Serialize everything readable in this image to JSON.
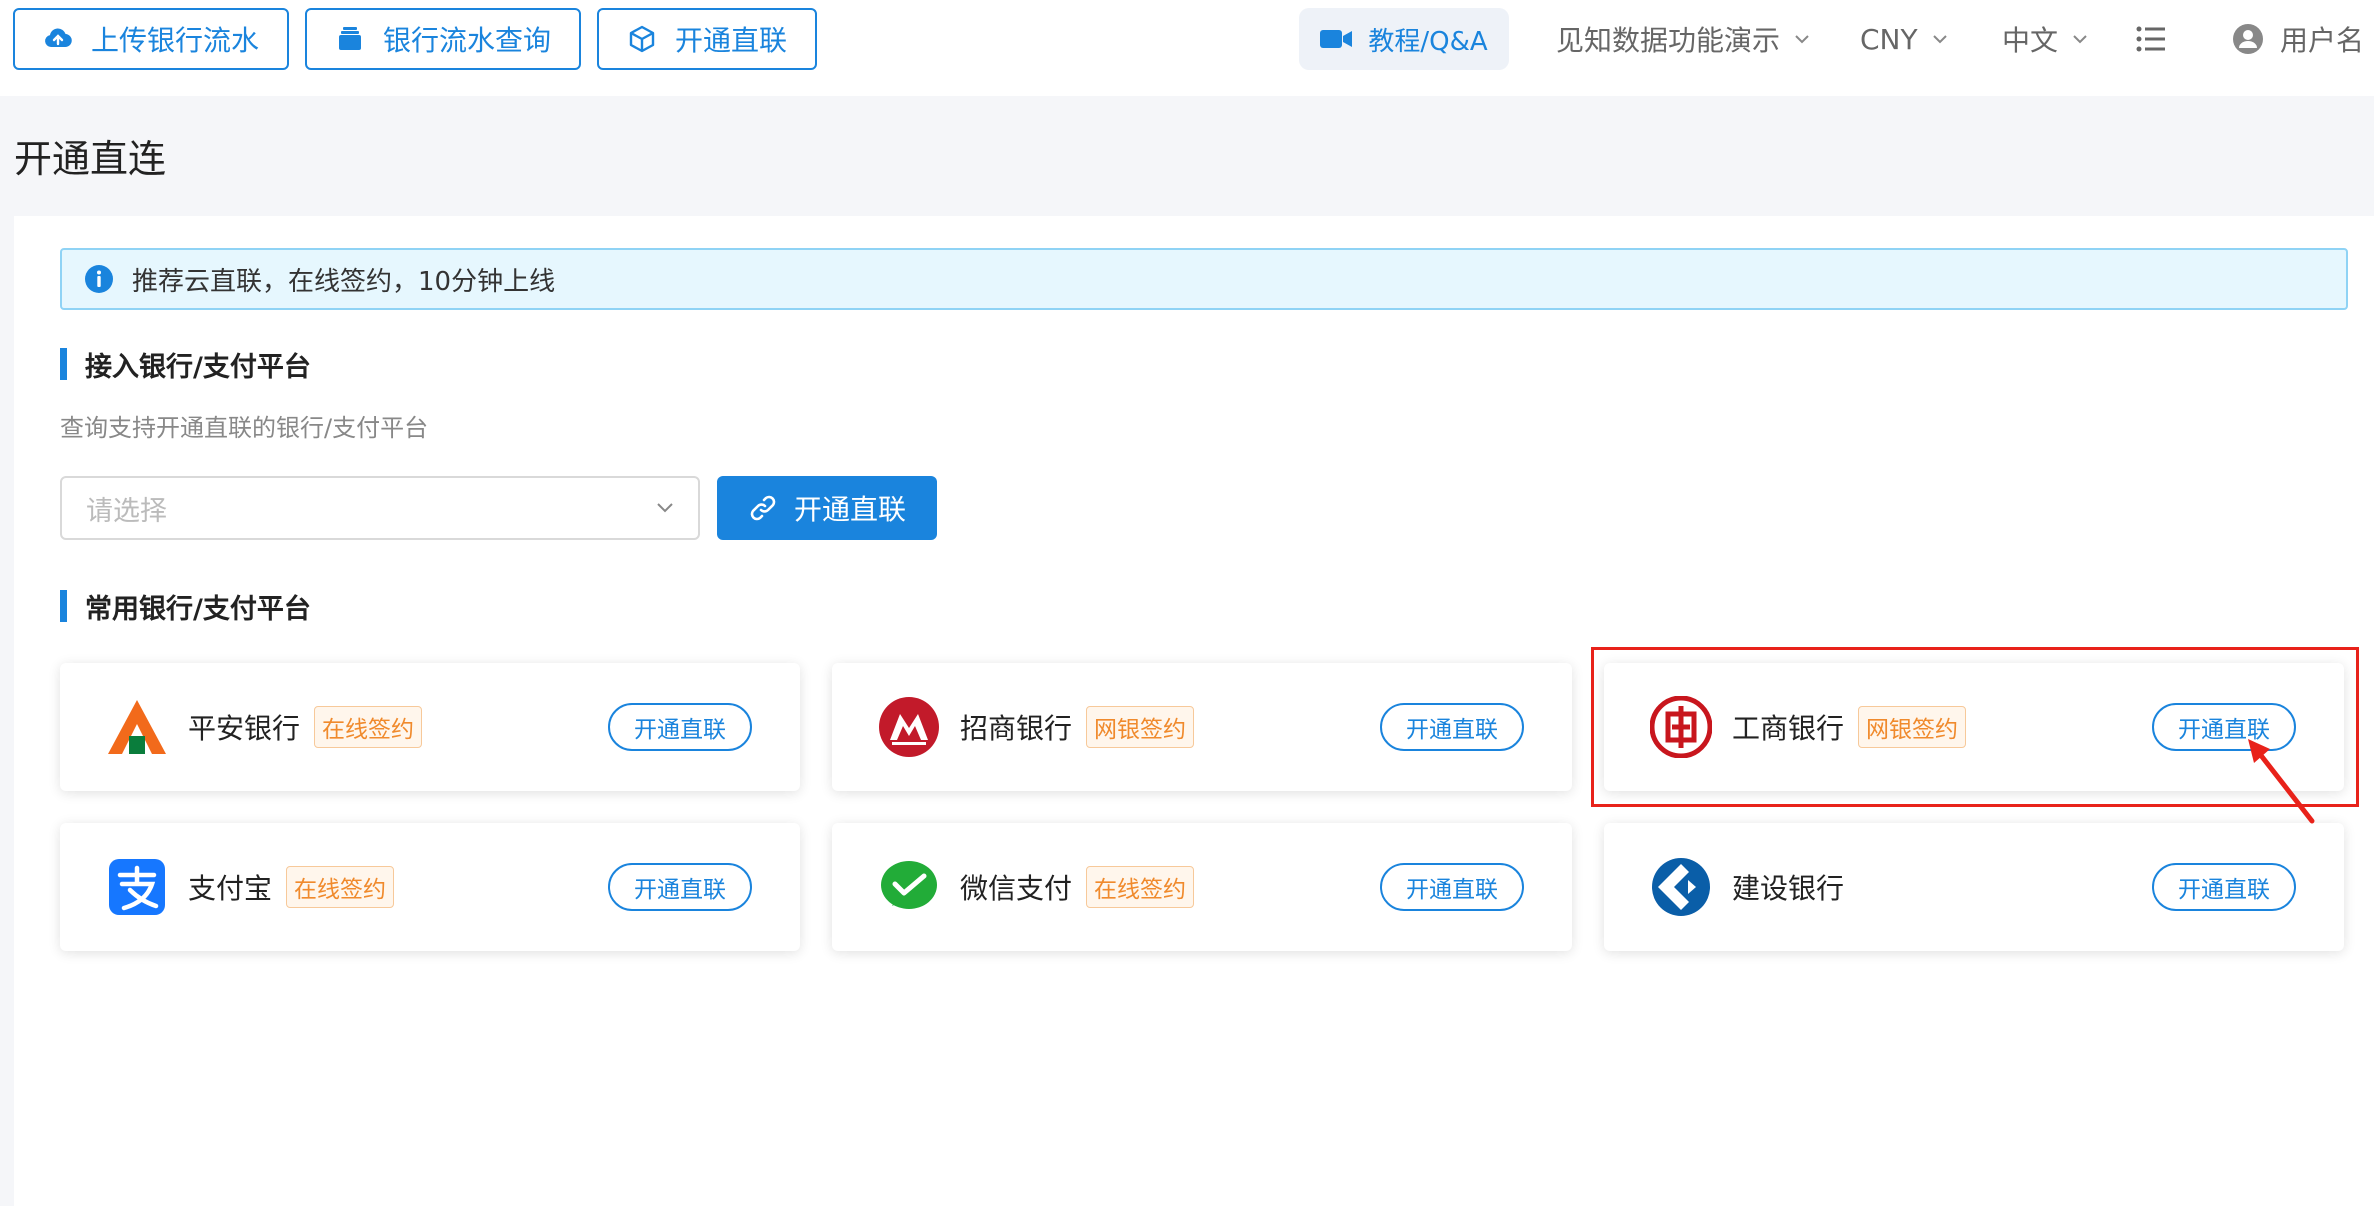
{
  "topbar": {
    "buttons": [
      {
        "label": "上传银行流水",
        "icon": "cloud-upload-icon"
      },
      {
        "label": "银行流水查询",
        "icon": "stack-icon"
      },
      {
        "label": "开通直联",
        "icon": "cube-icon"
      }
    ],
    "tutorial_label": "教程/Q&A",
    "company": "见知数据功能演示",
    "currency": "CNY",
    "language": "中文",
    "user": "用户名"
  },
  "page_title": "开通直连",
  "alert": {
    "text": "推荐云直联，在线签约，10分钟上线"
  },
  "section1": {
    "title": "接入银行/支付平台",
    "desc": "查询支持开通直联的银行/支付平台",
    "select_placeholder": "请选择",
    "button_label": "开通直联"
  },
  "section2": {
    "title": "常用银行/支付平台",
    "cards": [
      {
        "name": "平安银行",
        "tag": "在线签约",
        "button": "开通直联",
        "logo": "pingan-logo-icon"
      },
      {
        "name": "招商银行",
        "tag": "网银签约",
        "button": "开通直联",
        "logo": "cmb-logo-icon"
      },
      {
        "name": "工商银行",
        "tag": "网银签约",
        "button": "开通直联",
        "logo": "icbc-logo-icon"
      },
      {
        "name": "支付宝",
        "tag": "在线签约",
        "button": "开通直联",
        "logo": "alipay-logo-icon"
      },
      {
        "name": "微信支付",
        "tag": "在线签约",
        "button": "开通直联",
        "logo": "wechat-pay-logo-icon"
      },
      {
        "name": "建设银行",
        "tag": "",
        "button": "开通直联",
        "logo": "ccb-logo-icon"
      }
    ]
  },
  "colors": {
    "accent": "#1a84dd",
    "tag": "#f08a2c",
    "highlight": "#e8221a"
  }
}
